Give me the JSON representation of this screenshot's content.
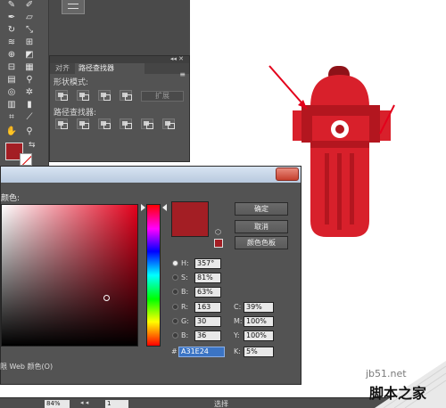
{
  "pathfinder_panel": {
    "tab_align": "对齐",
    "tab_pathfinder": "路径查找器",
    "shape_modes_label": "形状模式:",
    "pathfinders_label": "路径查找器:",
    "expand_label": "扩展"
  },
  "color_picker": {
    "select_color_label": "颜色:",
    "ok_label": "确定",
    "cancel_label": "取消",
    "swatches_label": "颜色色板",
    "hsb": [
      {
        "label": "H:",
        "value": "357°",
        "checked": true
      },
      {
        "label": "S:",
        "value": "81%",
        "checked": false
      },
      {
        "label": "B:",
        "value": "63%",
        "checked": false
      }
    ],
    "rgb": [
      {
        "label": "R:",
        "value": "163"
      },
      {
        "label": "G:",
        "value": "30"
      },
      {
        "label": "B:",
        "value": "36"
      }
    ],
    "cmyk": [
      {
        "label": "C:",
        "value": "39%"
      },
      {
        "label": "M:",
        "value": "100%"
      },
      {
        "label": "Y:",
        "value": "100%"
      },
      {
        "label": "K:",
        "value": "5%"
      }
    ],
    "hash": "#",
    "hex_value": "A31E24",
    "web_only_label": "限 Web 颜色(O)",
    "current_color": "#A31E24"
  },
  "statusbar": {
    "zoom": "84%",
    "page": "1",
    "selection_label": "选择"
  },
  "watermark": {
    "site": "jb51.net",
    "name": "脚本之家"
  },
  "colors": {
    "hydrant_red": "#D8202B",
    "hydrant_dark": "#B3161F",
    "hydrant_cap": "#8E1218",
    "arrow_red": "#E3001B",
    "panel_bg": "#535353"
  }
}
